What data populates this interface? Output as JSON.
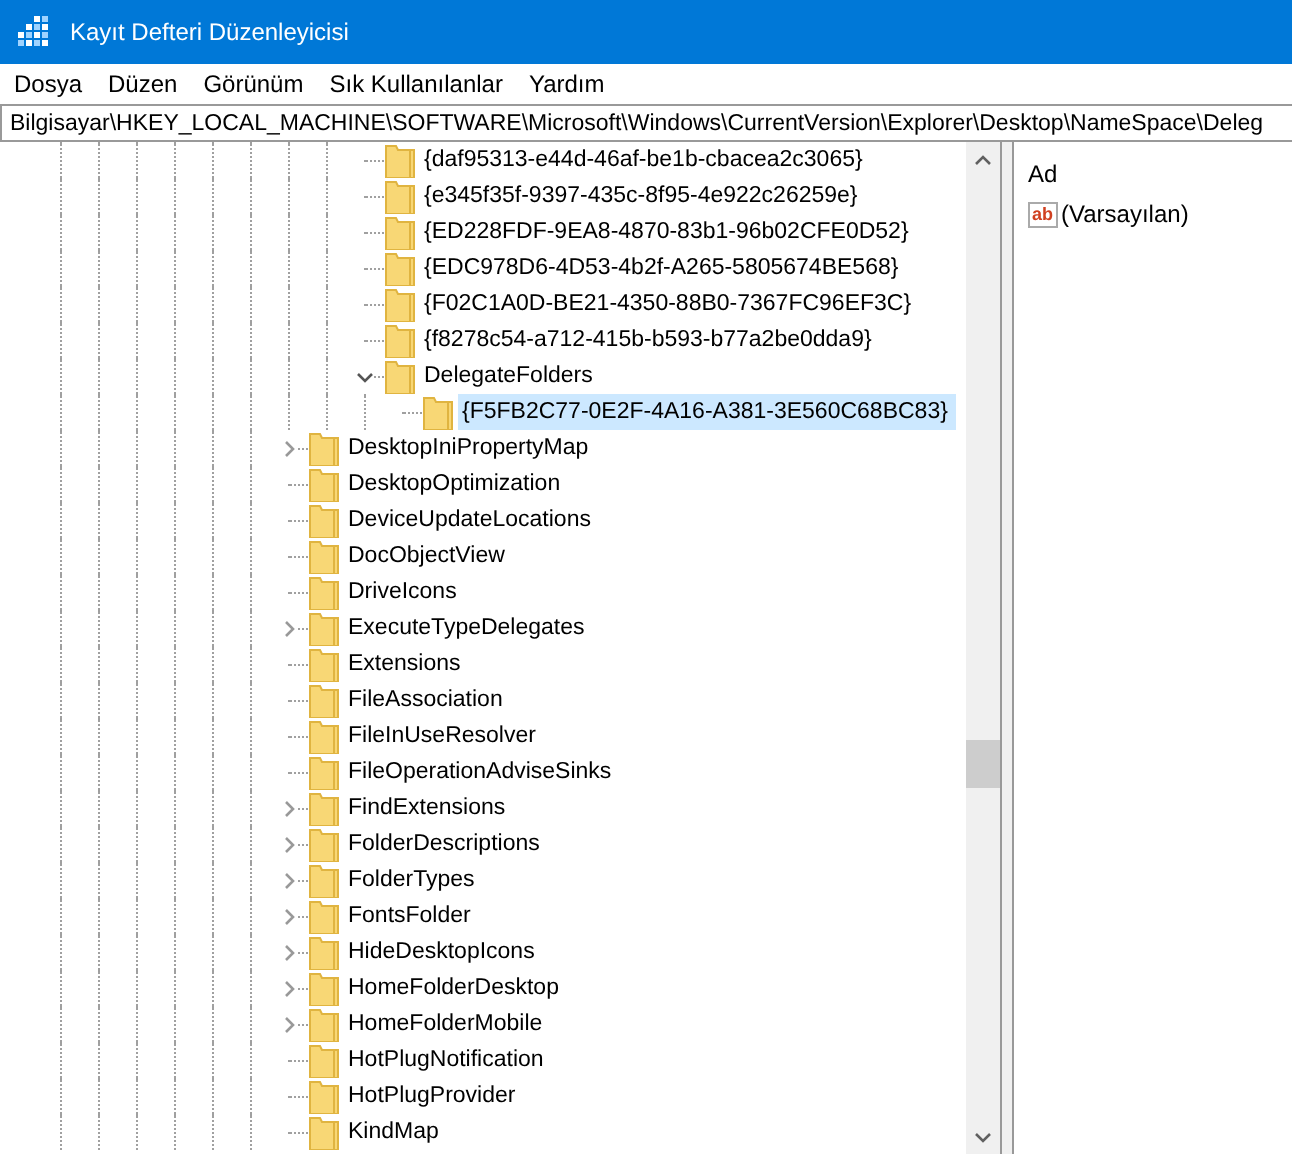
{
  "window": {
    "title": "Kayıt Defteri Düzenleyicisi"
  },
  "menu": [
    "Dosya",
    "Düzen",
    "Görünüm",
    "Sık Kullanılanlar",
    "Yardım"
  ],
  "address": "Bilgisayar\\HKEY_LOCAL_MACHINE\\SOFTWARE\\Microsoft\\Windows\\CurrentVersion\\Explorer\\Desktop\\NameSpace\\Deleg",
  "tree": {
    "items": [
      {
        "children": [
          {
            "children": [
              {
                "label": "{daf95313-e44d-46af-be1b-cbacea2c3065}",
                "expandable": false,
                "selected": false
              },
              {
                "label": "{e345f35f-9397-435c-8f95-4e922c26259e}",
                "expandable": false,
                "selected": false
              },
              {
                "label": "{ED228FDF-9EA8-4870-83b1-96b02CFE0D52}",
                "expandable": false,
                "selected": false
              },
              {
                "label": "{EDC978D6-4D53-4b2f-A265-5805674BE568}",
                "expandable": false,
                "selected": false
              },
              {
                "label": "{F02C1A0D-BE21-4350-88B0-7367FC96EF3C}",
                "expandable": false,
                "selected": false
              },
              {
                "label": "{f8278c54-a712-415b-b593-b77a2be0dda9}",
                "expandable": false,
                "selected": false
              },
              {
                "label": "DelegateFolders",
                "expandable": true,
                "expanded": true,
                "selected": false,
                "children": [
                  {
                    "label": "{F5FB2C77-0E2F-4A16-A381-3E560C68BC83}",
                    "expandable": false,
                    "selected": true
                  }
                ]
              }
            ]
          }
        ]
      },
      {
        "label": "DesktopIniPropertyMap",
        "expandable": true,
        "expanded": false,
        "selected": false
      },
      {
        "label": "DesktopOptimization",
        "expandable": false,
        "selected": false
      },
      {
        "label": "DeviceUpdateLocations",
        "expandable": false,
        "selected": false
      },
      {
        "label": "DocObjectView",
        "expandable": false,
        "selected": false
      },
      {
        "label": "DriveIcons",
        "expandable": false,
        "selected": false
      },
      {
        "label": "ExecuteTypeDelegates",
        "expandable": true,
        "expanded": false,
        "selected": false
      },
      {
        "label": "Extensions",
        "expandable": false,
        "selected": false
      },
      {
        "label": "FileAssociation",
        "expandable": false,
        "selected": false
      },
      {
        "label": "FileInUseResolver",
        "expandable": false,
        "selected": false
      },
      {
        "label": "FileOperationAdviseSinks",
        "expandable": false,
        "selected": false
      },
      {
        "label": "FindExtensions",
        "expandable": true,
        "expanded": false,
        "selected": false
      },
      {
        "label": "FolderDescriptions",
        "expandable": true,
        "expanded": false,
        "selected": false
      },
      {
        "label": "FolderTypes",
        "expandable": true,
        "expanded": false,
        "selected": false
      },
      {
        "label": "FontsFolder",
        "expandable": true,
        "expanded": false,
        "selected": false
      },
      {
        "label": "HideDesktopIcons",
        "expandable": true,
        "expanded": false,
        "selected": false
      },
      {
        "label": "HomeFolderDesktop",
        "expandable": true,
        "expanded": false,
        "selected": false
      },
      {
        "label": "HomeFolderMobile",
        "expandable": true,
        "expanded": false,
        "selected": false
      },
      {
        "label": "HotPlugNotification",
        "expandable": false,
        "selected": false
      },
      {
        "label": "HotPlugProvider",
        "expandable": false,
        "selected": false
      },
      {
        "label": "KindMap",
        "expandable": false,
        "selected": false
      }
    ]
  },
  "values": {
    "columns": [
      "Ad"
    ],
    "rows": [
      {
        "icon": "ab",
        "name": "(Varsayılan)"
      }
    ]
  }
}
